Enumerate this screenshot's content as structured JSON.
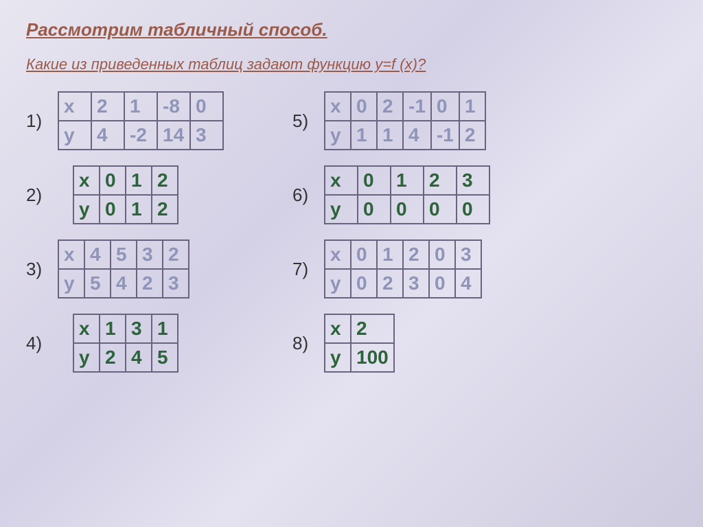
{
  "title": "Рассмотрим табличный способ.",
  "subtitle": "Какие из приведенных таблиц задают функцию y=f (x)?",
  "labels": {
    "n1": "1)",
    "n2": "2)",
    "n3": "3)",
    "n4": "4)",
    "n5": "5)",
    "n6": "6)",
    "n7": "7)",
    "n8": "8)"
  },
  "sym": {
    "x": "х",
    "y": "у"
  },
  "t1": {
    "x": [
      "2",
      "1",
      "-8",
      "0"
    ],
    "y": [
      "4",
      "-2",
      "14",
      "3"
    ]
  },
  "t2": {
    "x": [
      "0",
      "1",
      "2"
    ],
    "y": [
      "0",
      "1",
      "2"
    ]
  },
  "t3": {
    "x": [
      "4",
      "5",
      "3",
      "2"
    ],
    "y": [
      "5",
      "4",
      "2",
      "3"
    ]
  },
  "t4": {
    "x": [
      "1",
      "3",
      "1"
    ],
    "y": [
      "2",
      "4",
      "5"
    ]
  },
  "t5": {
    "x": [
      "0",
      "2",
      "-1",
      "0",
      "1"
    ],
    "y": [
      "1",
      "1",
      "4",
      "-1",
      "2"
    ]
  },
  "t6": {
    "x": [
      "0",
      "1",
      "2",
      "3"
    ],
    "y": [
      "0",
      "0",
      "0",
      "0"
    ]
  },
  "t7": {
    "x": [
      "0",
      "1",
      "2",
      "0",
      "3"
    ],
    "y": [
      "0",
      "2",
      "3",
      "0",
      "4"
    ]
  },
  "t8": {
    "x": [
      "2"
    ],
    "y": [
      "100"
    ]
  }
}
